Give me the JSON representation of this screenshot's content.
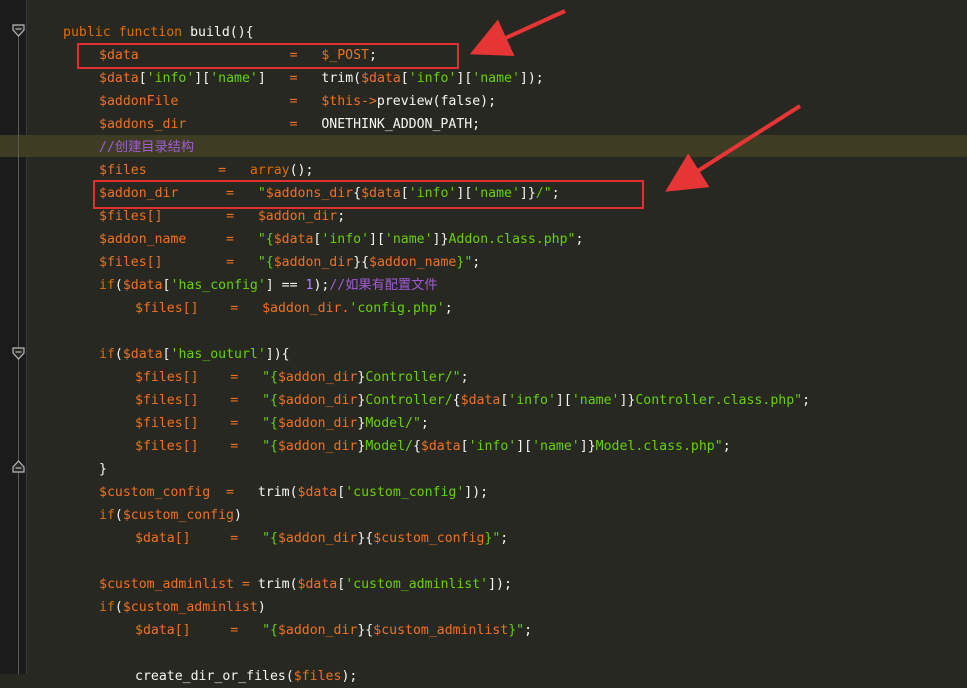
{
  "colors": {
    "kw": "#e06c00",
    "fn": "#a6a6a6",
    "plain": "#f8f8f2",
    "var": "#f07020",
    "str": "#66d200",
    "comment": "#a15bd6",
    "number": "#ae81ff",
    "highlight_box": "#e03030"
  },
  "lines": [
    {
      "indent": 1,
      "tokens": [
        {
          "t": "public",
          "c": "kw"
        },
        {
          "t": " ",
          "c": "plain"
        },
        {
          "t": "function",
          "c": "kw"
        },
        {
          "t": " build(){",
          "c": "plain"
        }
      ]
    },
    {
      "indent": 2,
      "tokens": [
        {
          "t": "$data",
          "c": "var"
        },
        {
          "t": "                   ",
          "c": "plain"
        },
        {
          "t": "=",
          "c": "var"
        },
        {
          "t": "   ",
          "c": "plain"
        },
        {
          "t": "$_POST",
          "c": "var"
        },
        {
          "t": ";",
          "c": "plain"
        }
      ]
    },
    {
      "indent": 2,
      "tokens": [
        {
          "t": "$data",
          "c": "var"
        },
        {
          "t": "[",
          "c": "plain"
        },
        {
          "t": "'info'",
          "c": "str"
        },
        {
          "t": "][",
          "c": "plain"
        },
        {
          "t": "'name'",
          "c": "str"
        },
        {
          "t": "]",
          "c": "plain"
        },
        {
          "t": "   ",
          "c": "plain"
        },
        {
          "t": "=",
          "c": "var"
        },
        {
          "t": "   trim(",
          "c": "plain"
        },
        {
          "t": "$data",
          "c": "var"
        },
        {
          "t": "[",
          "c": "plain"
        },
        {
          "t": "'info'",
          "c": "str"
        },
        {
          "t": "][",
          "c": "plain"
        },
        {
          "t": "'name'",
          "c": "str"
        },
        {
          "t": "]);",
          "c": "plain"
        }
      ]
    },
    {
      "indent": 2,
      "tokens": [
        {
          "t": "$addonFile",
          "c": "var"
        },
        {
          "t": "              ",
          "c": "plain"
        },
        {
          "t": "=",
          "c": "var"
        },
        {
          "t": "   ",
          "c": "plain"
        },
        {
          "t": "$this->",
          "c": "var"
        },
        {
          "t": "preview(false);",
          "c": "plain"
        }
      ]
    },
    {
      "indent": 2,
      "tokens": [
        {
          "t": "$addons_dir",
          "c": "var"
        },
        {
          "t": "             ",
          "c": "plain"
        },
        {
          "t": "=",
          "c": "var"
        },
        {
          "t": "   ONETHINK_ADDON_PATH;",
          "c": "plain"
        }
      ]
    },
    {
      "indent": 2,
      "tokens": [
        {
          "t": "//创建目录结构",
          "c": "comment"
        }
      ]
    },
    {
      "indent": 2,
      "tokens": [
        {
          "t": "$files",
          "c": "var"
        },
        {
          "t": "         ",
          "c": "plain"
        },
        {
          "t": "=",
          "c": "var"
        },
        {
          "t": "   ",
          "c": "plain"
        },
        {
          "t": "array",
          "c": "kw"
        },
        {
          "t": "();",
          "c": "plain"
        }
      ]
    },
    {
      "indent": 2,
      "tokens": [
        {
          "t": "$addon_dir",
          "c": "var"
        },
        {
          "t": "      ",
          "c": "plain"
        },
        {
          "t": "=",
          "c": "var"
        },
        {
          "t": "   ",
          "c": "plain"
        },
        {
          "t": "\"",
          "c": "str"
        },
        {
          "t": "$addons_dir",
          "c": "var"
        },
        {
          "t": "{",
          "c": "plain"
        },
        {
          "t": "$data",
          "c": "var"
        },
        {
          "t": "[",
          "c": "plain"
        },
        {
          "t": "'info'",
          "c": "str"
        },
        {
          "t": "][",
          "c": "plain"
        },
        {
          "t": "'name'",
          "c": "str"
        },
        {
          "t": "]}",
          "c": "plain"
        },
        {
          "t": "/\"",
          "c": "str"
        },
        {
          "t": ";",
          "c": "plain"
        }
      ]
    },
    {
      "indent": 2,
      "tokens": [
        {
          "t": "$files[]",
          "c": "var"
        },
        {
          "t": "        ",
          "c": "plain"
        },
        {
          "t": "=",
          "c": "var"
        },
        {
          "t": "   ",
          "c": "plain"
        },
        {
          "t": "$addon_dir",
          "c": "var"
        },
        {
          "t": ";",
          "c": "plain"
        }
      ]
    },
    {
      "indent": 2,
      "tokens": [
        {
          "t": "$addon_name",
          "c": "var"
        },
        {
          "t": "     ",
          "c": "plain"
        },
        {
          "t": "=",
          "c": "var"
        },
        {
          "t": "   ",
          "c": "plain"
        },
        {
          "t": "\"{",
          "c": "str"
        },
        {
          "t": "$data",
          "c": "var"
        },
        {
          "t": "[",
          "c": "plain"
        },
        {
          "t": "'info'",
          "c": "str"
        },
        {
          "t": "][",
          "c": "plain"
        },
        {
          "t": "'name'",
          "c": "str"
        },
        {
          "t": "]}",
          "c": "plain"
        },
        {
          "t": "Addon.class.php\"",
          "c": "str"
        },
        {
          "t": ";",
          "c": "plain"
        }
      ]
    },
    {
      "indent": 2,
      "tokens": [
        {
          "t": "$files[]",
          "c": "var"
        },
        {
          "t": "        ",
          "c": "plain"
        },
        {
          "t": "=",
          "c": "var"
        },
        {
          "t": "   ",
          "c": "plain"
        },
        {
          "t": "\"{",
          "c": "str"
        },
        {
          "t": "$addon_dir",
          "c": "var"
        },
        {
          "t": "}{",
          "c": "plain"
        },
        {
          "t": "$addon_name",
          "c": "var"
        },
        {
          "t": "}\"",
          "c": "str"
        },
        {
          "t": ";",
          "c": "plain"
        }
      ]
    },
    {
      "indent": 2,
      "tokens": [
        {
          "t": "if",
          "c": "kw"
        },
        {
          "t": "(",
          "c": "plain"
        },
        {
          "t": "$data",
          "c": "var"
        },
        {
          "t": "[",
          "c": "plain"
        },
        {
          "t": "'has_config'",
          "c": "str"
        },
        {
          "t": "] == ",
          "c": "plain"
        },
        {
          "t": "1",
          "c": "number"
        },
        {
          "t": ");",
          "c": "plain"
        },
        {
          "t": "//如果有配置文件",
          "c": "comment"
        }
      ]
    },
    {
      "indent": 3,
      "tokens": [
        {
          "t": "$files[]",
          "c": "var"
        },
        {
          "t": "    ",
          "c": "plain"
        },
        {
          "t": "=",
          "c": "var"
        },
        {
          "t": "   ",
          "c": "plain"
        },
        {
          "t": "$addon_dir.",
          "c": "var"
        },
        {
          "t": "'config.php'",
          "c": "str"
        },
        {
          "t": ";",
          "c": "plain"
        }
      ]
    },
    {
      "indent": 0,
      "tokens": []
    },
    {
      "indent": 2,
      "tokens": [
        {
          "t": "if",
          "c": "kw"
        },
        {
          "t": "(",
          "c": "plain"
        },
        {
          "t": "$data",
          "c": "var"
        },
        {
          "t": "[",
          "c": "plain"
        },
        {
          "t": "'has_outurl'",
          "c": "str"
        },
        {
          "t": "]){",
          "c": "plain"
        }
      ]
    },
    {
      "indent": 3,
      "tokens": [
        {
          "t": "$files[]",
          "c": "var"
        },
        {
          "t": "    ",
          "c": "plain"
        },
        {
          "t": "=",
          "c": "var"
        },
        {
          "t": "   ",
          "c": "plain"
        },
        {
          "t": "\"{",
          "c": "str"
        },
        {
          "t": "$addon_dir",
          "c": "var"
        },
        {
          "t": "}",
          "c": "plain"
        },
        {
          "t": "Controller/\"",
          "c": "str"
        },
        {
          "t": ";",
          "c": "plain"
        }
      ]
    },
    {
      "indent": 3,
      "tokens": [
        {
          "t": "$files[]",
          "c": "var"
        },
        {
          "t": "    ",
          "c": "plain"
        },
        {
          "t": "=",
          "c": "var"
        },
        {
          "t": "   ",
          "c": "plain"
        },
        {
          "t": "\"{",
          "c": "str"
        },
        {
          "t": "$addon_dir",
          "c": "var"
        },
        {
          "t": "}",
          "c": "plain"
        },
        {
          "t": "Controller/",
          "c": "str"
        },
        {
          "t": "{",
          "c": "plain"
        },
        {
          "t": "$data",
          "c": "var"
        },
        {
          "t": "[",
          "c": "plain"
        },
        {
          "t": "'info'",
          "c": "str"
        },
        {
          "t": "][",
          "c": "plain"
        },
        {
          "t": "'name'",
          "c": "str"
        },
        {
          "t": "]}",
          "c": "plain"
        },
        {
          "t": "Controller.class.php\"",
          "c": "str"
        },
        {
          "t": ";",
          "c": "plain"
        }
      ]
    },
    {
      "indent": 3,
      "tokens": [
        {
          "t": "$files[]",
          "c": "var"
        },
        {
          "t": "    ",
          "c": "plain"
        },
        {
          "t": "=",
          "c": "var"
        },
        {
          "t": "   ",
          "c": "plain"
        },
        {
          "t": "\"{",
          "c": "str"
        },
        {
          "t": "$addon_dir",
          "c": "var"
        },
        {
          "t": "}",
          "c": "plain"
        },
        {
          "t": "Model/\"",
          "c": "str"
        },
        {
          "t": ";",
          "c": "plain"
        }
      ]
    },
    {
      "indent": 3,
      "tokens": [
        {
          "t": "$files[]",
          "c": "var"
        },
        {
          "t": "    ",
          "c": "plain"
        },
        {
          "t": "=",
          "c": "var"
        },
        {
          "t": "   ",
          "c": "plain"
        },
        {
          "t": "\"{",
          "c": "str"
        },
        {
          "t": "$addon_dir",
          "c": "var"
        },
        {
          "t": "}",
          "c": "plain"
        },
        {
          "t": "Model/",
          "c": "str"
        },
        {
          "t": "{",
          "c": "plain"
        },
        {
          "t": "$data",
          "c": "var"
        },
        {
          "t": "[",
          "c": "plain"
        },
        {
          "t": "'info'",
          "c": "str"
        },
        {
          "t": "][",
          "c": "plain"
        },
        {
          "t": "'name'",
          "c": "str"
        },
        {
          "t": "]}",
          "c": "plain"
        },
        {
          "t": "Model.class.php\"",
          "c": "str"
        },
        {
          "t": ";",
          "c": "plain"
        }
      ]
    },
    {
      "indent": 2,
      "tokens": [
        {
          "t": "}",
          "c": "plain"
        }
      ]
    },
    {
      "indent": 2,
      "tokens": [
        {
          "t": "$custom_config",
          "c": "var"
        },
        {
          "t": "  ",
          "c": "plain"
        },
        {
          "t": "=",
          "c": "var"
        },
        {
          "t": "   trim(",
          "c": "plain"
        },
        {
          "t": "$data",
          "c": "var"
        },
        {
          "t": "[",
          "c": "plain"
        },
        {
          "t": "'custom_config'",
          "c": "str"
        },
        {
          "t": "]);",
          "c": "plain"
        }
      ]
    },
    {
      "indent": 2,
      "tokens": [
        {
          "t": "if",
          "c": "kw"
        },
        {
          "t": "(",
          "c": "plain"
        },
        {
          "t": "$custom_config",
          "c": "var"
        },
        {
          "t": ")",
          "c": "plain"
        }
      ]
    },
    {
      "indent": 3,
      "tokens": [
        {
          "t": "$data[]",
          "c": "var"
        },
        {
          "t": "     ",
          "c": "plain"
        },
        {
          "t": "=",
          "c": "var"
        },
        {
          "t": "   ",
          "c": "plain"
        },
        {
          "t": "\"{",
          "c": "str"
        },
        {
          "t": "$addon_dir",
          "c": "var"
        },
        {
          "t": "}{",
          "c": "plain"
        },
        {
          "t": "$custom_config",
          "c": "var"
        },
        {
          "t": "}\"",
          "c": "str"
        },
        {
          "t": ";",
          "c": "plain"
        }
      ]
    },
    {
      "indent": 0,
      "tokens": []
    },
    {
      "indent": 2,
      "tokens": [
        {
          "t": "$custom_adminlist",
          "c": "var"
        },
        {
          "t": " ",
          "c": "plain"
        },
        {
          "t": "=",
          "c": "var"
        },
        {
          "t": " trim(",
          "c": "plain"
        },
        {
          "t": "$data",
          "c": "var"
        },
        {
          "t": "[",
          "c": "plain"
        },
        {
          "t": "'custom_adminlist'",
          "c": "str"
        },
        {
          "t": "]);",
          "c": "plain"
        }
      ]
    },
    {
      "indent": 2,
      "tokens": [
        {
          "t": "if",
          "c": "kw"
        },
        {
          "t": "(",
          "c": "plain"
        },
        {
          "t": "$custom_adminlist",
          "c": "var"
        },
        {
          "t": ")",
          "c": "plain"
        }
      ]
    },
    {
      "indent": 3,
      "tokens": [
        {
          "t": "$data[]",
          "c": "var"
        },
        {
          "t": "     ",
          "c": "plain"
        },
        {
          "t": "=",
          "c": "var"
        },
        {
          "t": "   ",
          "c": "plain"
        },
        {
          "t": "\"{",
          "c": "str"
        },
        {
          "t": "$addon_dir",
          "c": "var"
        },
        {
          "t": "}{",
          "c": "plain"
        },
        {
          "t": "$custom_adminlist",
          "c": "var"
        },
        {
          "t": "}\"",
          "c": "str"
        },
        {
          "t": ";",
          "c": "plain"
        }
      ]
    },
    {
      "indent": 0,
      "tokens": []
    },
    {
      "indent": 3,
      "tokens": [
        {
          "t": "create_dir_or_files(",
          "c": "plain"
        },
        {
          "t": "$files",
          "c": "var"
        },
        {
          "t": ");",
          "c": "plain"
        }
      ]
    }
  ],
  "gutter_icons": [
    "fold-open-icon",
    "fold-open-icon",
    "fold-end-icon"
  ]
}
